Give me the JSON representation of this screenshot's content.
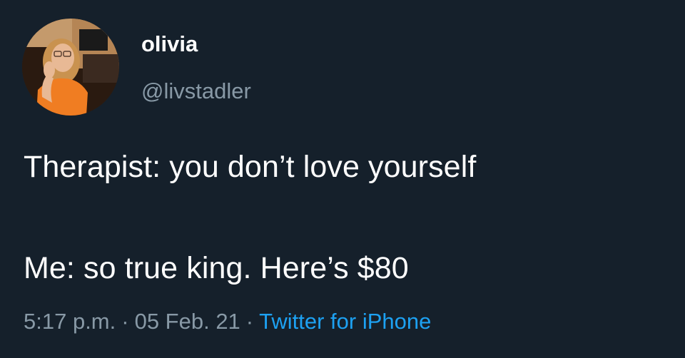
{
  "author": {
    "display_name": "olivia",
    "handle": "@livstadler"
  },
  "tweet": {
    "line1": "Therapist: you don’t love yourself",
    "line2": "Me: so true king. Here’s $80"
  },
  "meta": {
    "time": "5:17 p.m.",
    "separator": "·",
    "date": "05 Feb. 21",
    "source": "Twitter for iPhone"
  },
  "colors": {
    "background": "#15202b",
    "text": "#ffffff",
    "secondary_text": "#8899a6",
    "link": "#1da1f2"
  }
}
